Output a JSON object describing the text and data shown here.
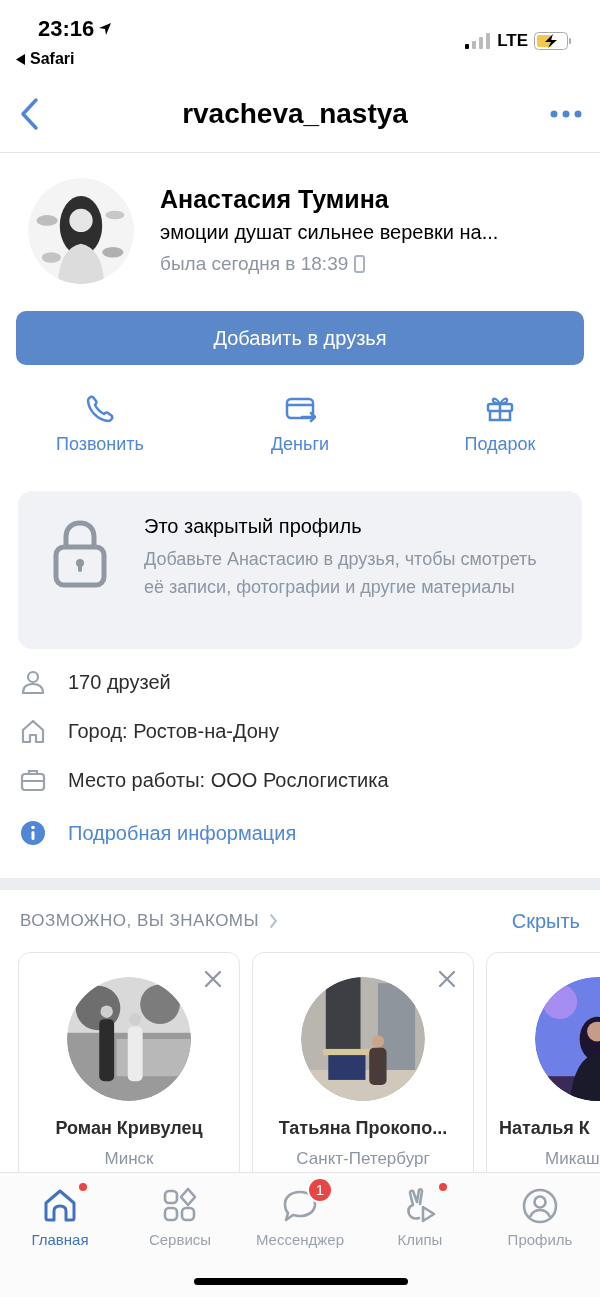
{
  "status_bar": {
    "time": "23:16",
    "back_app": "Safari",
    "network": "LTE"
  },
  "nav": {
    "title": "rvacheva_nastya"
  },
  "profile": {
    "name": "Анастасия Тумина",
    "status": "эмоции душат сильнее веревки на...",
    "last_seen": "была сегодня в 18:39"
  },
  "add_button": "Добавить в друзья",
  "actions": [
    {
      "kind": "call",
      "label": "Позвонить"
    },
    {
      "kind": "money",
      "label": "Деньги"
    },
    {
      "kind": "gift",
      "label": "Подарок"
    }
  ],
  "closed_profile": {
    "title": "Это закрытый профиль",
    "text": "Добавьте Анастасию в друзья, чтобы смотреть её записи, фотографии и другие материалы"
  },
  "info": [
    {
      "kind": "friends",
      "text": "170 друзей"
    },
    {
      "kind": "city",
      "text": "Город: Ростов-на-Дону"
    },
    {
      "kind": "work",
      "text": "Место работы: ООО Рослогистика"
    },
    {
      "kind": "details",
      "text": "Подробная информация"
    }
  ],
  "suggestions": {
    "title": "ВОЗМОЖНО, ВЫ ЗНАКОМЫ",
    "hide": "Скрыть",
    "people": [
      {
        "name": "Роман Кривулец",
        "city": "Минск",
        "dismissible": true
      },
      {
        "name": "Татьяна Прокопо...",
        "city": "Санкт-Петербург",
        "dismissible": true
      },
      {
        "name": "Наталья К",
        "city": "Микаш",
        "dismissible": false
      }
    ]
  },
  "tabs": [
    {
      "kind": "home",
      "label": "Главная",
      "selected": true,
      "dot": true
    },
    {
      "kind": "services",
      "label": "Сервисы",
      "selected": false,
      "dot": false
    },
    {
      "kind": "messenger",
      "label": "Мессенджер",
      "selected": false,
      "dot": false,
      "badge": "1"
    },
    {
      "kind": "clips",
      "label": "Клипы",
      "selected": false,
      "dot": true
    },
    {
      "kind": "profile",
      "label": "Профиль",
      "selected": false,
      "dot": false
    }
  ]
}
